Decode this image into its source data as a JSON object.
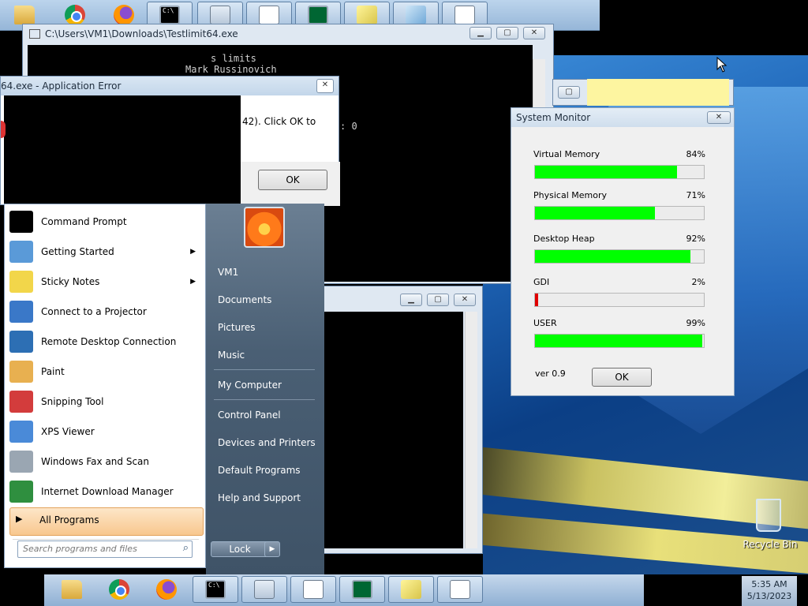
{
  "console_main": {
    "title": "C:\\Users\\VM1\\Downloads\\Testlimit64.exe",
    "lines": [
      "s limits",
      "Mark Russinovich"
    ],
    "fragment": ": 0"
  },
  "error_dialog": {
    "title": "64.exe - Application Error",
    "message": "42). Click OK to",
    "ok_label": "OK"
  },
  "start_menu": {
    "programs": [
      {
        "label": "Command Prompt",
        "icon": "cmd-icon",
        "has_submenu": false
      },
      {
        "label": "Getting Started",
        "icon": "getting-started-icon",
        "has_submenu": true
      },
      {
        "label": "Sticky Notes",
        "icon": "sticky-notes-icon",
        "has_submenu": true
      },
      {
        "label": "Connect to a Projector",
        "icon": "projector-icon",
        "has_submenu": false
      },
      {
        "label": "Remote Desktop Connection",
        "icon": "remote-desktop-icon",
        "has_submenu": false
      },
      {
        "label": "Paint",
        "icon": "paint-icon",
        "has_submenu": false
      },
      {
        "label": "Snipping Tool",
        "icon": "snipping-tool-icon",
        "has_submenu": false
      },
      {
        "label": "XPS Viewer",
        "icon": "xps-viewer-icon",
        "has_submenu": false
      },
      {
        "label": "Windows Fax and Scan",
        "icon": "fax-scan-icon",
        "has_submenu": false
      },
      {
        "label": "Internet Download Manager",
        "icon": "idm-icon",
        "has_submenu": false
      }
    ],
    "all_programs": "All Programs",
    "search_placeholder": "Search programs and files",
    "right_links": [
      "VM1",
      "Documents",
      "Pictures",
      "Music",
      "My Computer",
      "Control Panel",
      "Devices and Printers",
      "Default Programs",
      "Help and Support"
    ],
    "lock_label": "Lock",
    "colors": {
      "highlight": "#fbd3a3",
      "right_pane": "#4a5f74"
    }
  },
  "system_monitor": {
    "title": "System Monitor",
    "metrics": [
      {
        "label": "Virtual Memory",
        "percent_text": "84%",
        "value": 84,
        "color": "#00ff00"
      },
      {
        "label": "Physical Memory",
        "percent_text": "71%",
        "value": 71,
        "color": "#00ff00"
      },
      {
        "label": "Desktop Heap",
        "percent_text": "92%",
        "value": 92,
        "color": "#00ff00"
      },
      {
        "label": "GDI",
        "percent_text": "2%",
        "value": 2,
        "color": "#e00000"
      },
      {
        "label": "USER",
        "percent_text": "99%",
        "value": 99,
        "color": "#00ff00"
      }
    ],
    "version": "ver 0.9",
    "ok_label": "OK"
  },
  "desktop": {
    "recycle_bin_label": "Recycle Bin"
  },
  "taskbar": {
    "time": "5:35 AM",
    "date": "5/13/2023",
    "buttons": [
      "explorer-icon",
      "chrome-icon",
      "firefox-icon",
      "cmd-icon",
      "calculator-icon",
      "document-icon",
      "system-monitor-icon",
      "sticky-notes-icon",
      "document-icon"
    ]
  }
}
